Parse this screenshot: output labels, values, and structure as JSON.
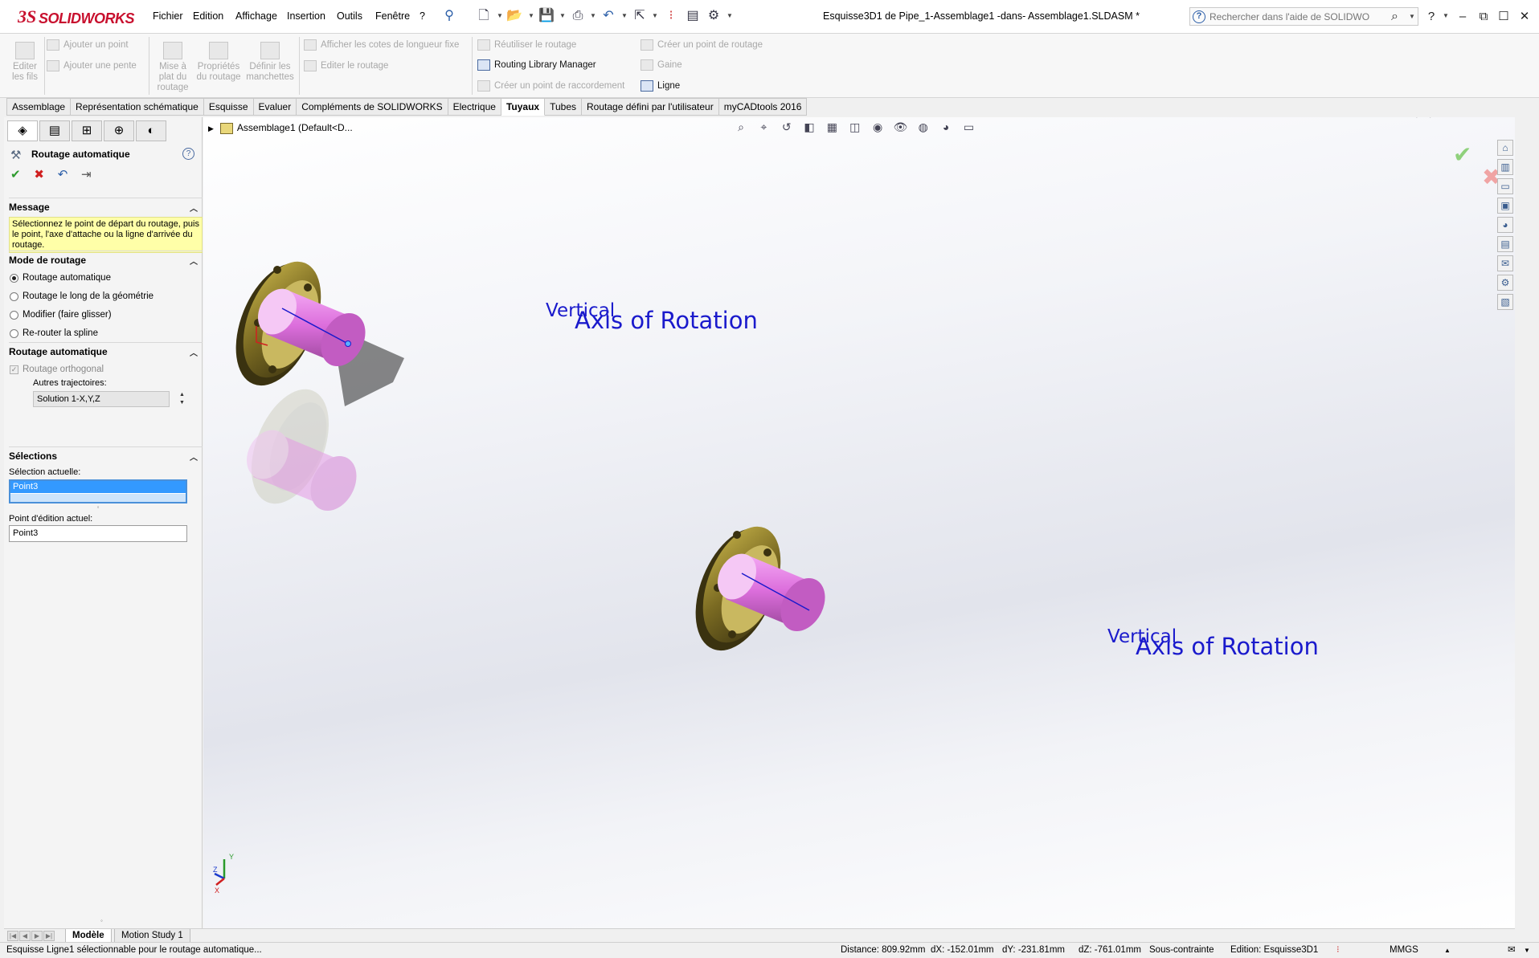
{
  "app": {
    "brand": "SOLIDWORKS",
    "brand_prefix": "3S"
  },
  "menu": [
    "Fichier",
    "Edition",
    "Affichage",
    "Insertion",
    "Outils",
    "Fenêtre",
    "?"
  ],
  "document_title": "Esquisse3D1 de Pipe_1-Assemblage1 -dans- Assemblage1.SLDASM *",
  "help_search": {
    "placeholder": "Rechercher dans l'aide de SOLIDWORKS"
  },
  "ribbon": {
    "edit_wires": "Editer les fils",
    "add_point": "Ajouter un point",
    "add_slope": "Ajouter une pente",
    "flatten_route": "Mise à plat du routage",
    "route_properties": "Propriétés du routage",
    "define_sleeves": "Définir les manchettes",
    "show_length_dims": "Afficher les cotes de longueur fixe",
    "edit_route": "Editer le routage",
    "reuse_route": "Réutiliser le routage",
    "routing_library_manager": "Routing Library Manager",
    "create_connection_point": "Créer un point de raccordement",
    "create_route_point": "Créer un point de routage",
    "sheath": "Gaine",
    "line": "Ligne"
  },
  "tabs": [
    "Assemblage",
    "Représentation schématique",
    "Esquisse",
    "Evaluer",
    "Compléments de SOLIDWORKS",
    "Electrique",
    "Tuyaux",
    "Tubes",
    "Routage défini par l'utilisateur",
    "myCADtools 2016"
  ],
  "active_tab": "Tuyaux",
  "property_manager": {
    "title": "Routage automatique",
    "message_header": "Message",
    "message_text": "Sélectionnez le point de départ du routage, puis le point, l'axe d'attache ou la ligne d'arrivée du routage.",
    "mode_header": "Mode de routage",
    "modes": [
      "Routage automatique",
      "Routage le long de la géométrie",
      "Modifier (faire glisser)",
      "Re-router la spline"
    ],
    "selected_mode": "Routage automatique",
    "auto_header": "Routage automatique",
    "orthogonal_label": "Routage orthogonal",
    "alt_paths_label": "Autres trajectoires:",
    "alt_paths_value": "Solution 1-X,Y,Z",
    "selections_header": "Sélections",
    "current_selection_label": "Sélection actuelle:",
    "current_selection_item": "Point3",
    "edit_point_label": "Point d'édition actuel:",
    "edit_point_value": "Point3"
  },
  "viewport": {
    "tree_root": "Assemblage1  (Default<D...",
    "annotations": [
      {
        "vertical": "Vertical",
        "axis": "Axis of Rotation"
      },
      {
        "vertical": "Vertical",
        "axis": "Axis of Rotation"
      }
    ],
    "triad": {
      "y": "Y",
      "z": "Z",
      "x": "X"
    }
  },
  "bottom_tabs": [
    "Modèle",
    "Motion Study 1"
  ],
  "status": {
    "message": "Esquisse Ligne1 sélectionnable pour le routage automatique...",
    "distance": "Distance: 809.92mm",
    "dx": "dX: -152.01mm",
    "dy": "dY: -231.81mm",
    "dz": "dZ: -761.01mm",
    "constraint": "Sous-contrainte",
    "editing": "Edition: Esquisse3D1",
    "units": "MMGS"
  },
  "colors": {
    "brand": "#c8102e",
    "annotation": "#1a1acc",
    "pipe": "#e07ae0",
    "flange": "#8a7a2e",
    "message_bg": "#ffffa8"
  }
}
